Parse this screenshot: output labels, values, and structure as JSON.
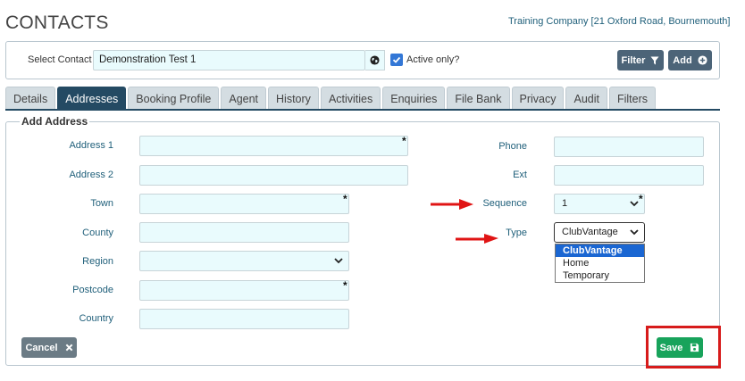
{
  "header": {
    "title": "CONTACTS",
    "company": "Training Company [21 Oxford Road, Bournemouth]"
  },
  "contact_bar": {
    "select_label": "Select Contact",
    "select_value": "Demonstration Test 1",
    "active_only_label": "Active only?",
    "active_only_checked": true,
    "filter_label": "Filter",
    "add_label": "Add"
  },
  "tabs": [
    {
      "label": "Details",
      "active": false
    },
    {
      "label": "Addresses",
      "active": true
    },
    {
      "label": "Booking Profile",
      "active": false
    },
    {
      "label": "Agent",
      "active": false
    },
    {
      "label": "History",
      "active": false
    },
    {
      "label": "Activities",
      "active": false
    },
    {
      "label": "Enquiries",
      "active": false
    },
    {
      "label": "File Bank",
      "active": false
    },
    {
      "label": "Privacy",
      "active": false
    },
    {
      "label": "Audit",
      "active": false
    },
    {
      "label": "Filters",
      "active": false
    }
  ],
  "form": {
    "legend": "Add Address",
    "required_mark": "*",
    "left_fields": {
      "address1": {
        "label": "Address 1",
        "value": ""
      },
      "address2": {
        "label": "Address 2",
        "value": ""
      },
      "town": {
        "label": "Town",
        "value": ""
      },
      "county": {
        "label": "County",
        "value": ""
      },
      "region": {
        "label": "Region",
        "value": ""
      },
      "postcode": {
        "label": "Postcode",
        "value": ""
      },
      "country": {
        "label": "Country",
        "value": ""
      }
    },
    "right_fields": {
      "phone": {
        "label": "Phone",
        "value": ""
      },
      "ext": {
        "label": "Ext",
        "value": ""
      },
      "sequence": {
        "label": "Sequence",
        "value": "1"
      },
      "type": {
        "label": "Type",
        "value": "ClubVantage",
        "options": [
          "ClubVantage",
          "Home",
          "Temporary"
        ]
      }
    },
    "cancel_label": "Cancel",
    "save_label": "Save"
  },
  "colors": {
    "accent": "#244a63",
    "input_bg": "#e9fbfd",
    "save_green": "#18a35b",
    "highlight_red": "#d71b1b"
  }
}
